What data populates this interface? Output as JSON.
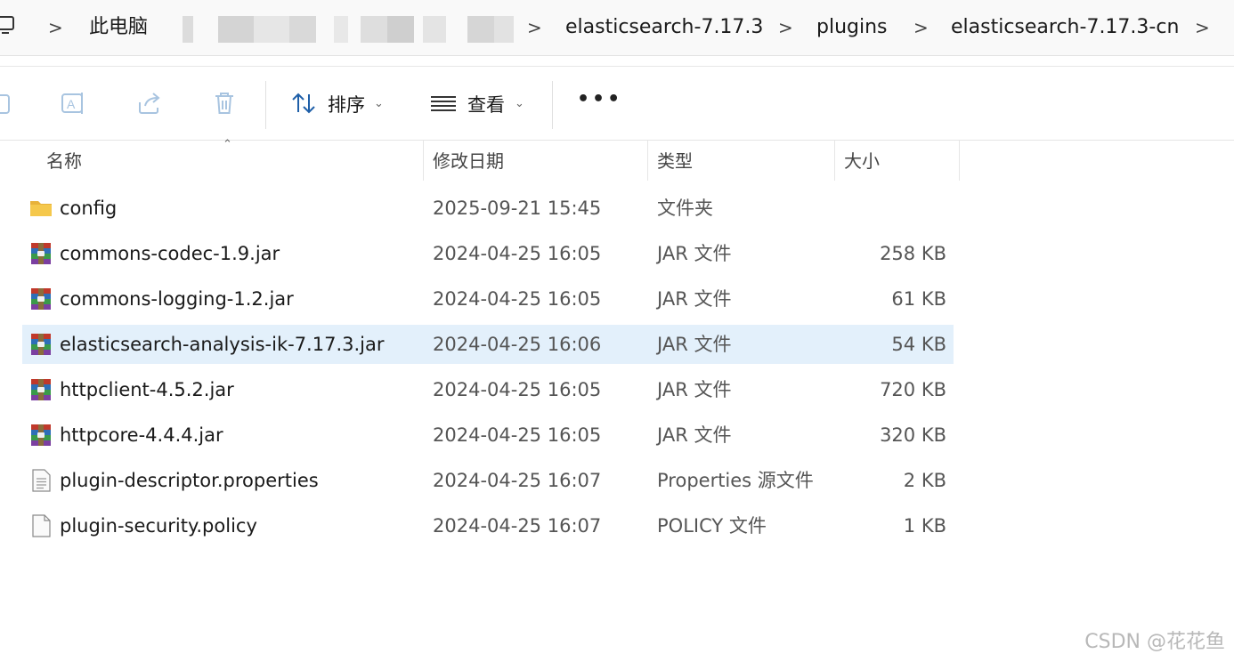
{
  "breadcrumb": {
    "items": [
      "此电脑",
      "elasticsearch-7.17.3",
      "plugins",
      "elasticsearch-7.17.3-cn"
    ],
    "separator": ">"
  },
  "toolbar": {
    "sort_label": "排序",
    "view_label": "查看",
    "more_label": "•••"
  },
  "columns": {
    "name": "名称",
    "date": "修改日期",
    "type": "类型",
    "size": "大小"
  },
  "files": [
    {
      "name": "config",
      "date": "2025-09-21 15:45",
      "type": "文件夹",
      "size": "",
      "icon": "folder-icon"
    },
    {
      "name": "commons-codec-1.9.jar",
      "date": "2024-04-25 16:05",
      "type": "JAR 文件",
      "size": "258 KB",
      "icon": "jar-archive-icon"
    },
    {
      "name": "commons-logging-1.2.jar",
      "date": "2024-04-25 16:05",
      "type": "JAR 文件",
      "size": "61 KB",
      "icon": "jar-archive-icon"
    },
    {
      "name": "elasticsearch-analysis-ik-7.17.3.jar",
      "date": "2024-04-25 16:06",
      "type": "JAR 文件",
      "size": "54 KB",
      "icon": "jar-archive-icon",
      "selected": true
    },
    {
      "name": "httpclient-4.5.2.jar",
      "date": "2024-04-25 16:05",
      "type": "JAR 文件",
      "size": "720 KB",
      "icon": "jar-archive-icon"
    },
    {
      "name": "httpcore-4.4.4.jar",
      "date": "2024-04-25 16:05",
      "type": "JAR 文件",
      "size": "320 KB",
      "icon": "jar-archive-icon"
    },
    {
      "name": "plugin-descriptor.properties",
      "date": "2024-04-25 16:07",
      "type": "Properties 源文件",
      "size": "2 KB",
      "icon": "text-file-icon"
    },
    {
      "name": "plugin-security.policy",
      "date": "2024-04-25 16:07",
      "type": "POLICY 文件",
      "size": "1 KB",
      "icon": "blank-file-icon"
    }
  ],
  "watermark": "CSDN @花花鱼",
  "colors": {
    "selection": "#e3f0fb",
    "folder": "#f5c84c"
  }
}
